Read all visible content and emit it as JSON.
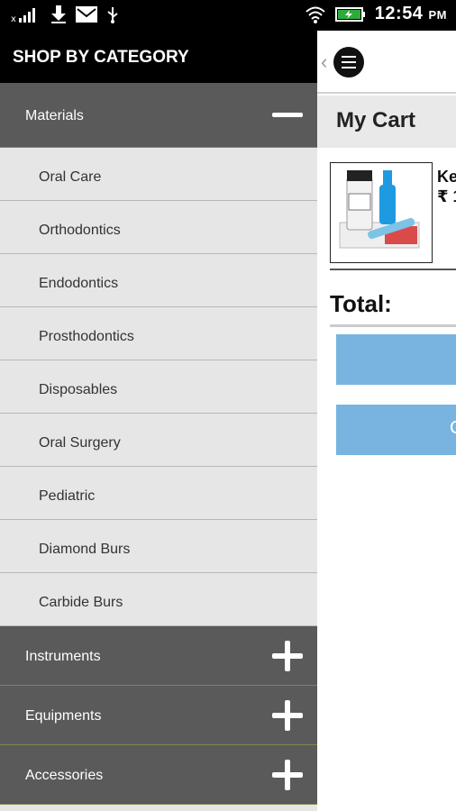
{
  "status_bar": {
    "time": "12:54",
    "ampm": "PM",
    "icons": [
      "signal-off-icon",
      "download-icon",
      "mail-icon",
      "usb-icon",
      "wifi-icon",
      "battery-charging-icon"
    ]
  },
  "drawer": {
    "title": "SHOP BY CATEGORY",
    "expanded_category": "Materials",
    "subcategories": [
      "Oral Care",
      "Orthodontics",
      "Endodontics",
      "Prosthodontics",
      "Disposables",
      "Oral Surgery",
      "Pediatric",
      "Diamond Burs",
      "Carbide Burs"
    ],
    "collapsed_categories": [
      "Instruments",
      "Equipments",
      "Accessories"
    ]
  },
  "cart": {
    "title": "My Cart",
    "item_name_partial": "Ke",
    "item_price_partial": "₹ 1",
    "total_label": "Total:",
    "button2_partial": "C"
  },
  "colors": {
    "drawer_category_bg": "#5a5a5a",
    "drawer_sub_bg": "#e6e6e6",
    "cart_button": "#78b4df",
    "header_bg": "#000000"
  }
}
